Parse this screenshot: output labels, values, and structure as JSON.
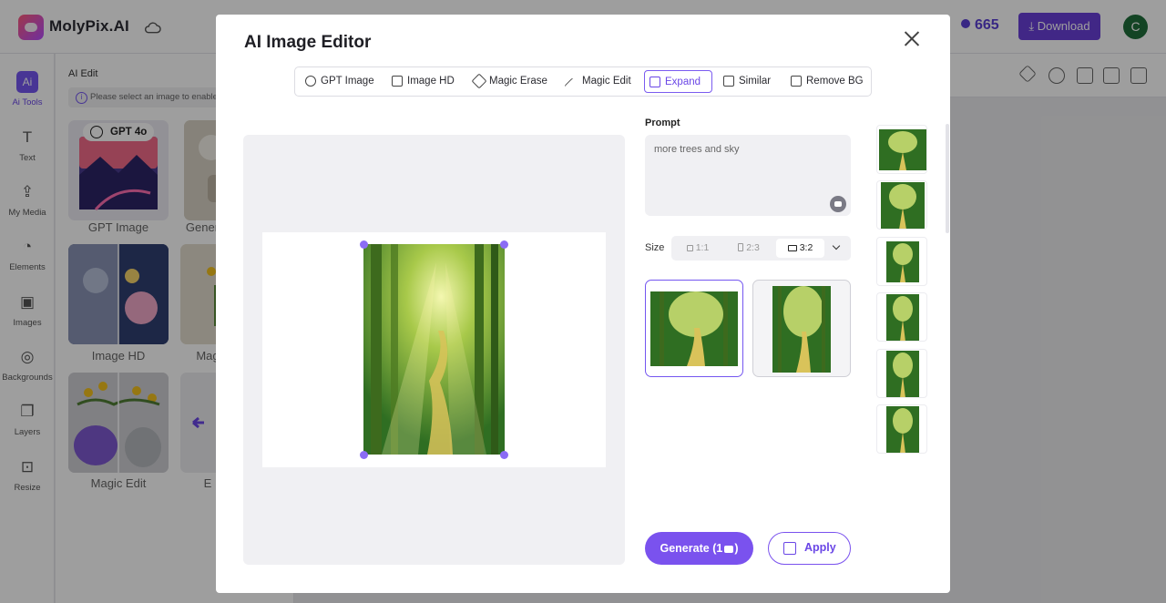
{
  "app": {
    "brand": "MolyPix.AI",
    "credits": "665",
    "download_label": "Download",
    "avatar_initial": "C"
  },
  "sidebar": {
    "items": [
      {
        "label": "Ai Tools",
        "icon": "ai-sparkle-icon",
        "glyph": "Ai"
      },
      {
        "label": "Text",
        "icon": "text-icon",
        "glyph": "T"
      },
      {
        "label": "My Media",
        "icon": "cloud-upload-icon",
        "glyph": "⇪"
      },
      {
        "label": "Elements",
        "icon": "shapes-icon",
        "glyph": "◔"
      },
      {
        "label": "Images",
        "icon": "image-icon",
        "glyph": "▣"
      },
      {
        "label": "Backgrounds",
        "icon": "palette-icon",
        "glyph": "◎"
      },
      {
        "label": "Layers",
        "icon": "layers-icon",
        "glyph": "❐"
      },
      {
        "label": "Resize",
        "icon": "resize-icon",
        "glyph": "⊡"
      }
    ]
  },
  "panel": {
    "title": "AI Edit",
    "notice": "Please select an image to enable",
    "badge": "GPT 4o",
    "tiles": [
      {
        "label": "GPT Image"
      },
      {
        "label": "Gener"
      },
      {
        "label": "Image HD"
      },
      {
        "label": "Mag"
      },
      {
        "label": "Magic Edit"
      },
      {
        "label": "E"
      }
    ]
  },
  "modal": {
    "title": "AI Image Editor",
    "tabs": [
      {
        "label": "GPT Image",
        "icon": "openai-icon"
      },
      {
        "label": "Image HD",
        "icon": "hd-icon"
      },
      {
        "label": "Magic Erase",
        "icon": "eraser-icon"
      },
      {
        "label": "Magic Edit",
        "icon": "magic-wand-icon"
      },
      {
        "label": "Expand",
        "icon": "expand-icon"
      },
      {
        "label": "Similar",
        "icon": "similar-icon"
      },
      {
        "label": "Remove BG",
        "icon": "remove-bg-icon"
      }
    ],
    "active_tab": "Expand",
    "prompt_label": "Prompt",
    "prompt_value": "more trees and sky",
    "size_label": "Size",
    "size_options": [
      "1:1",
      "2:3",
      "3:2"
    ],
    "size_selected": "3:2",
    "generate_label": "Generate",
    "generate_cost": "(1",
    "generate_cost_suffix": ")",
    "apply_label": "Apply"
  },
  "colors": {
    "accent": "#7a52ee",
    "brand_purple": "#6a3fd9",
    "avatar": "#1f6e3a"
  }
}
